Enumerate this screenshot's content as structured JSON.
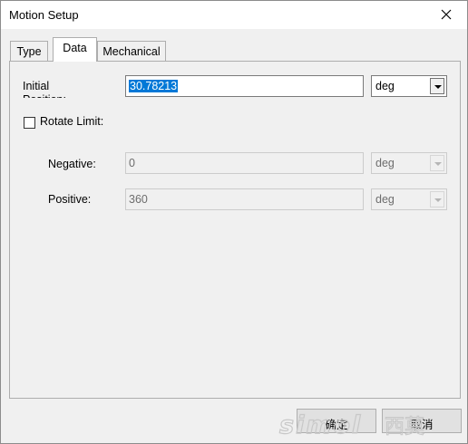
{
  "window": {
    "title": "Motion Setup"
  },
  "tabs": [
    {
      "label": "Type",
      "active": false
    },
    {
      "label": "Data",
      "active": true
    },
    {
      "label": "Mechanical",
      "active": false
    }
  ],
  "initial_position": {
    "label": "Initial Position:",
    "value": "30.78213",
    "unit": "deg"
  },
  "rotate_limit": {
    "label": "Rotate Limit:",
    "checked": false
  },
  "negative": {
    "label": "Negative:",
    "value": "0",
    "unit": "deg"
  },
  "positive": {
    "label": "Positive:",
    "value": "360",
    "unit": "deg"
  },
  "buttons": {
    "ok": "确定",
    "cancel": "取消"
  },
  "watermark": {
    "text": "simol",
    "cjk": "西莫"
  },
  "colors": {
    "selection": "#0078d7",
    "panel": "#f0f0f0"
  },
  "icons": {
    "close": "close-icon",
    "dropdown": "chevron-down-icon"
  }
}
